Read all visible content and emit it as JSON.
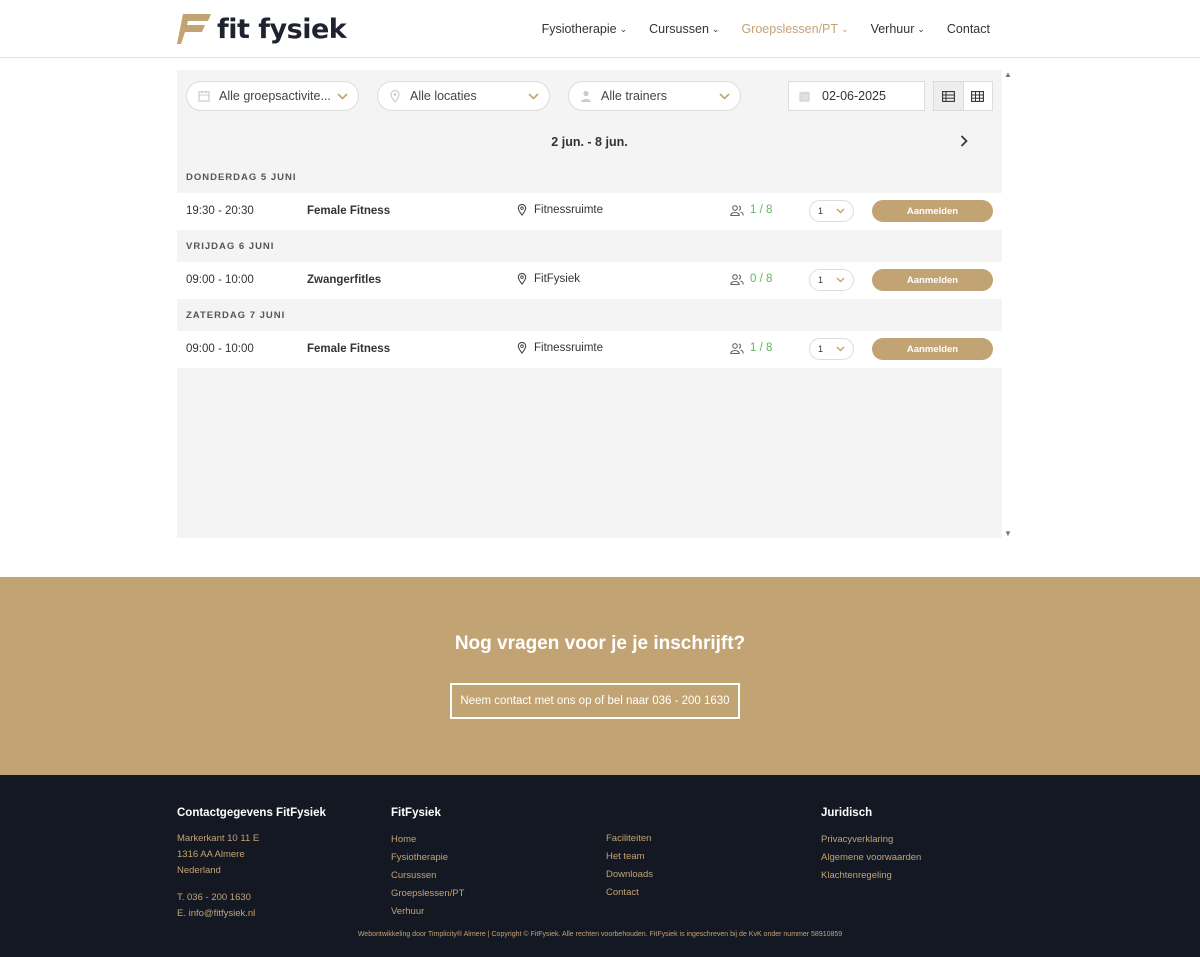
{
  "header": {
    "logo_text": "fit fysiek",
    "nav": [
      {
        "label": "Fysiotherapie",
        "active": false,
        "dropdown": true
      },
      {
        "label": "Cursussen",
        "active": false,
        "dropdown": true
      },
      {
        "label": "Groepslessen/PT",
        "active": true,
        "dropdown": true
      },
      {
        "label": "Verhuur",
        "active": false,
        "dropdown": true
      },
      {
        "label": "Contact",
        "active": false,
        "dropdown": false
      }
    ]
  },
  "filters": {
    "activities": "Alle groepsactivite...",
    "locations": "Alle locaties",
    "trainers": "Alle trainers",
    "date": "02-06-2025"
  },
  "schedule": {
    "week_label": "2 jun. - 8 jun.",
    "days": [
      {
        "header": "DONDERDAG 5 JUNI",
        "sessions": [
          {
            "time": "19:30 - 20:30",
            "title": "Female Fitness",
            "location": "Fitnessruimte",
            "capacity": "1 / 8",
            "qty": "1",
            "button": "Aanmelden"
          }
        ]
      },
      {
        "header": "VRIJDAG 6 JUNI",
        "sessions": [
          {
            "time": "09:00 - 10:00",
            "title": "Zwangerfitles",
            "location": "FitFysiek",
            "capacity": "0 / 8",
            "qty": "1",
            "button": "Aanmelden"
          }
        ]
      },
      {
        "header": "ZATERDAG 7 JUNI",
        "sessions": [
          {
            "time": "09:00 - 10:00",
            "title": "Female Fitness",
            "location": "Fitnessruimte",
            "capacity": "1 / 8",
            "qty": "1",
            "button": "Aanmelden"
          }
        ]
      }
    ]
  },
  "cta": {
    "title": "Nog vragen voor je je inschrijft?",
    "button": "Neem contact met ons op of bel naar 036 - 200 1630"
  },
  "footer": {
    "contact": {
      "heading": "Contactgegevens FitFysiek",
      "address": [
        "Markerkant 10 11 E",
        "1316 AA Almere",
        "Nederland"
      ],
      "phone": "T. 036 - 200 1630",
      "email": "E. info@fitfysiek.nl"
    },
    "fitfysiek": {
      "heading": "FitFysiek",
      "links_col1": [
        "Home",
        "Fysiotherapie",
        "Cursussen",
        "Groepslessen/PT",
        "Verhuur"
      ],
      "links_col2": [
        "Faciliteiten",
        "Het team",
        "Downloads",
        "Contact"
      ]
    },
    "juridisch": {
      "heading": "Juridisch",
      "links": [
        "Privacyverklaring",
        "Algemene voorwaarden",
        "Klachtenregeling"
      ]
    },
    "bottom": "Webontwikkeling door Timplicity® Almere | Copyright © FitFysiek. Alle rechten voorbehouden. FitFysiek is ingeschreven bij de KvK onder nummer 58910859"
  },
  "colors": {
    "accent": "#c2a374",
    "footer_bg": "#141823",
    "capacity_green": "#5cb85c"
  }
}
